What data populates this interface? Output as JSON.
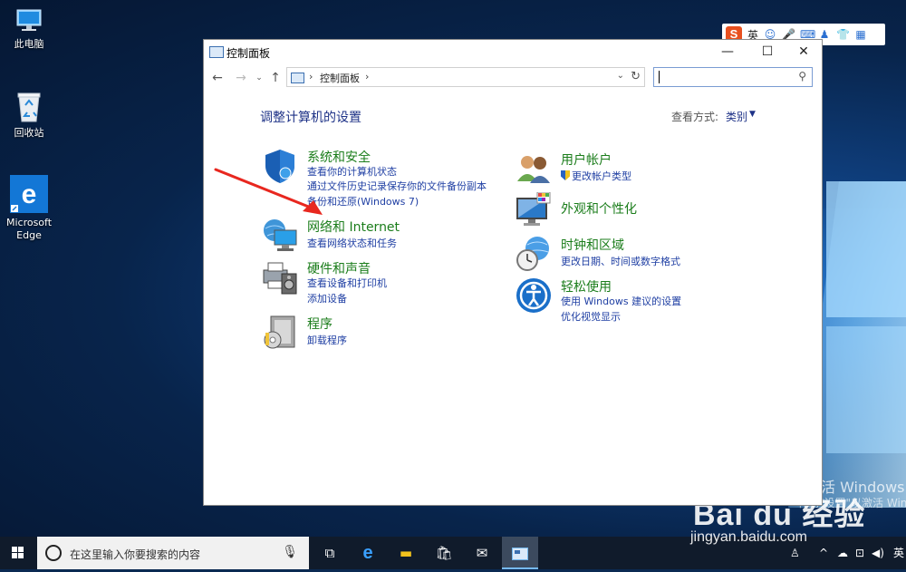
{
  "desktop": {
    "icons": [
      {
        "label": "此电脑"
      },
      {
        "label": "回收站"
      },
      {
        "label": "Microsoft\nEdge"
      }
    ],
    "activation_title": "激活 Windows",
    "activation_sub": "转到\"设置\"以激活 Windows",
    "watermark": "Bai du 经验",
    "watermark_url": "jingyan.baidu.com"
  },
  "ime": {
    "lang": "英"
  },
  "window": {
    "title": "控制面板",
    "controls": {
      "minimize": "—",
      "maximize": "☐",
      "close": "✕"
    },
    "address": {
      "crumb": "控制面板"
    },
    "search": {
      "placeholder": ""
    },
    "heading": "调整计算机的设置",
    "view_by_label": "查看方式:",
    "view_by_value": "类别",
    "left_categories": [
      {
        "title": "系统和安全",
        "links": [
          "查看你的计算机状态",
          "通过文件历史记录保存你的文件备份副本",
          "备份和还原(Windows 7)"
        ]
      },
      {
        "title": "网络和 Internet",
        "links": [
          "查看网络状态和任务"
        ]
      },
      {
        "title": "硬件和声音",
        "links": [
          "查看设备和打印机",
          "添加设备"
        ]
      },
      {
        "title": "程序",
        "links": [
          "卸载程序"
        ]
      }
    ],
    "right_categories": [
      {
        "title": "用户帐户",
        "links": [
          "更改帐户类型"
        ]
      },
      {
        "title": "外观和个性化",
        "links": []
      },
      {
        "title": "时钟和区域",
        "links": [
          "更改日期、时间或数字格式"
        ]
      },
      {
        "title": "轻松使用",
        "links": [
          "使用 Windows 建议的设置",
          "优化视觉显示"
        ]
      }
    ]
  },
  "taskbar": {
    "search_placeholder": "在这里输入你要搜索的内容",
    "tray_lang": "英"
  },
  "colors": {
    "accent": "#1e3287",
    "category": "#1b7d1b",
    "link": "#1f3fa3",
    "annotation_arrow": "#e8271f"
  }
}
